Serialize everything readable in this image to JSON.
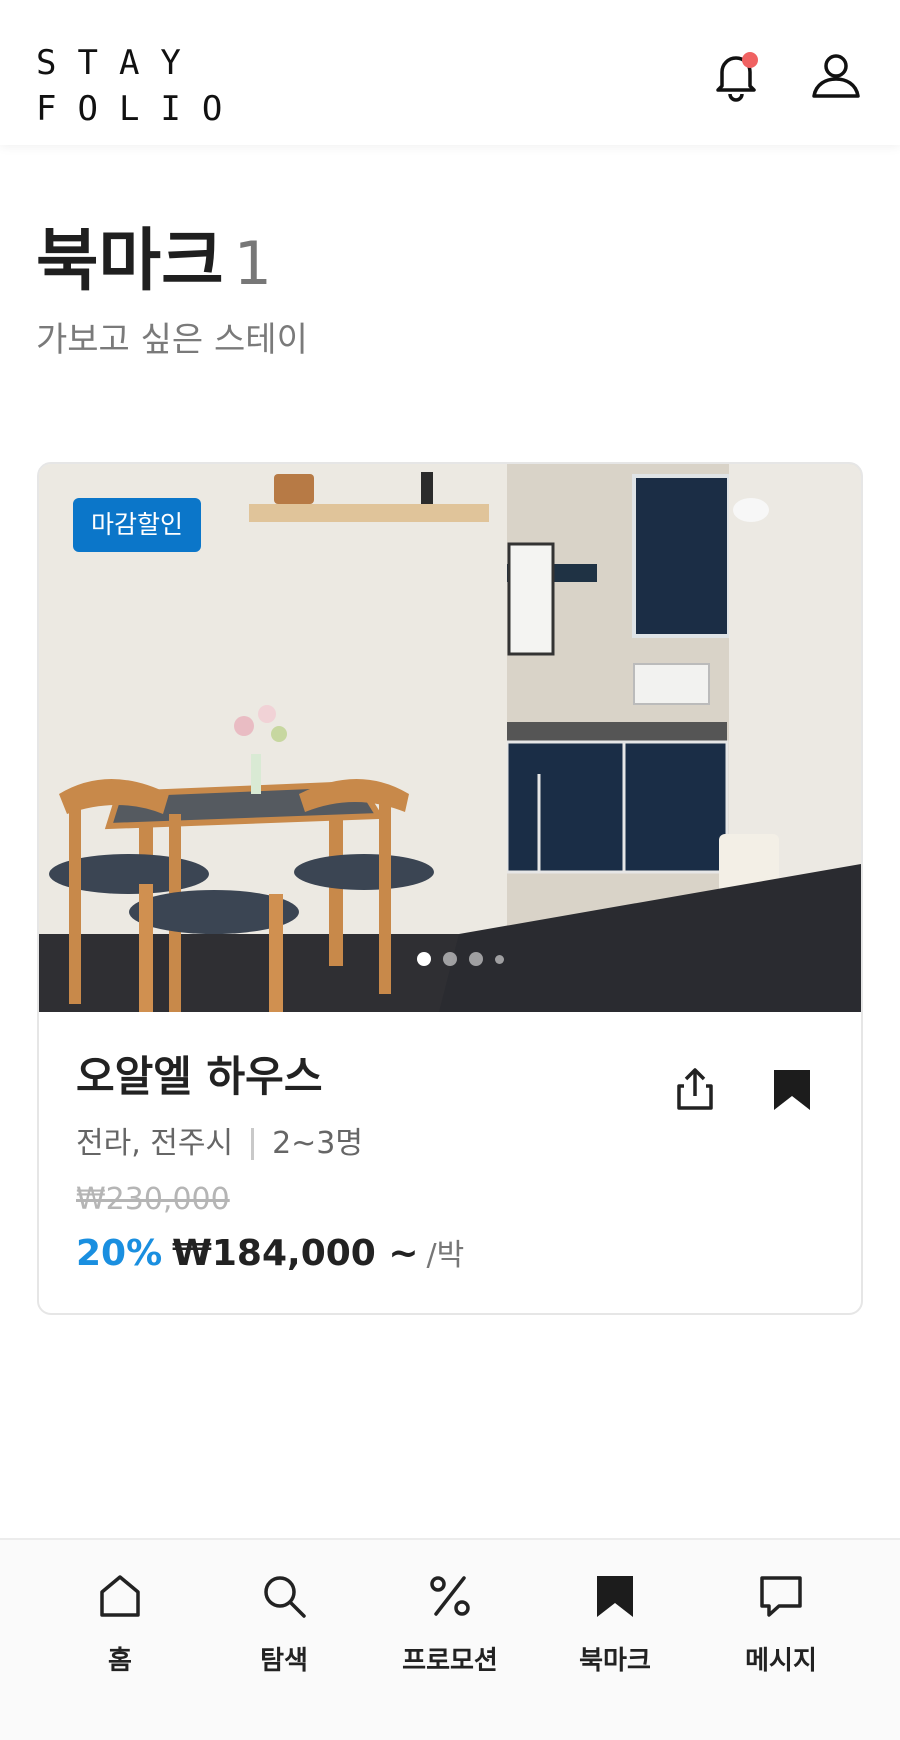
{
  "header": {
    "logo_line1": "STAY",
    "logo_line2": "FOLIO",
    "icons": [
      "bell-icon",
      "user-icon"
    ],
    "notification_dot_color": "#f06262"
  },
  "page": {
    "title": "북마크",
    "count": "1",
    "subtitle": "가보고 싶은 스테이"
  },
  "card": {
    "badge": "마감할인",
    "badge_color": "#0b76c9",
    "image_dots": 4,
    "active_dot": 1,
    "name": "오알엘 하우스",
    "location": "전라, 전주시",
    "guests": "2~3명",
    "original_price": "₩230,000",
    "discount": "20%",
    "price": "₩184,000 ~",
    "per_night": "/박",
    "discount_color": "#1a8fe0",
    "icons": [
      "share-icon",
      "bookmark-filled-icon"
    ]
  },
  "nav": {
    "items": [
      {
        "label": "홈",
        "icon": "home-icon"
      },
      {
        "label": "탐색",
        "icon": "search-icon"
      },
      {
        "label": "프로모션",
        "icon": "percent-icon"
      },
      {
        "label": "북마크",
        "icon": "bookmark-icon",
        "active": true
      },
      {
        "label": "메시지",
        "icon": "message-icon"
      }
    ]
  }
}
